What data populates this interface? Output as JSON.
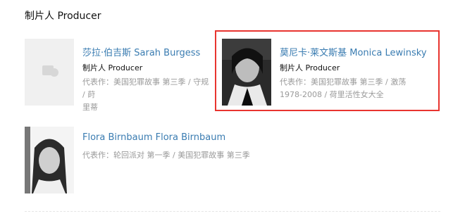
{
  "section": {
    "title": "制片人 Producer"
  },
  "colors": {
    "link": "#3a7cb1",
    "highlight_border": "#e8342f",
    "muted": "#9a9a9a"
  },
  "people": [
    {
      "name": "莎拉·伯吉斯 Sarah Burgess",
      "role": "制片人 Producer",
      "works_label": "代表作：",
      "works_line1": "美国犯罪故事 第三季 / 守规 / 莳",
      "works_line2": "里蒂",
      "photo": "placeholder-icon"
    },
    {
      "name": "莫尼卡·莱文斯基 Monica Lewinsky",
      "role": "制片人 Producer",
      "works_label": "代表作：",
      "works_line1": "美国犯罪故事 第三季 / 激荡",
      "works_line2": "1978-2008 / 荷里活性女大全",
      "photo": "portrait"
    },
    {
      "name": "Flora Birnbaum Flora Birnbaum",
      "role": "",
      "works_label": "代表作：",
      "works_line1": "轮回派对 第一季 / 美国犯罪故事 第三季",
      "works_line2": "",
      "photo": "portrait"
    }
  ]
}
